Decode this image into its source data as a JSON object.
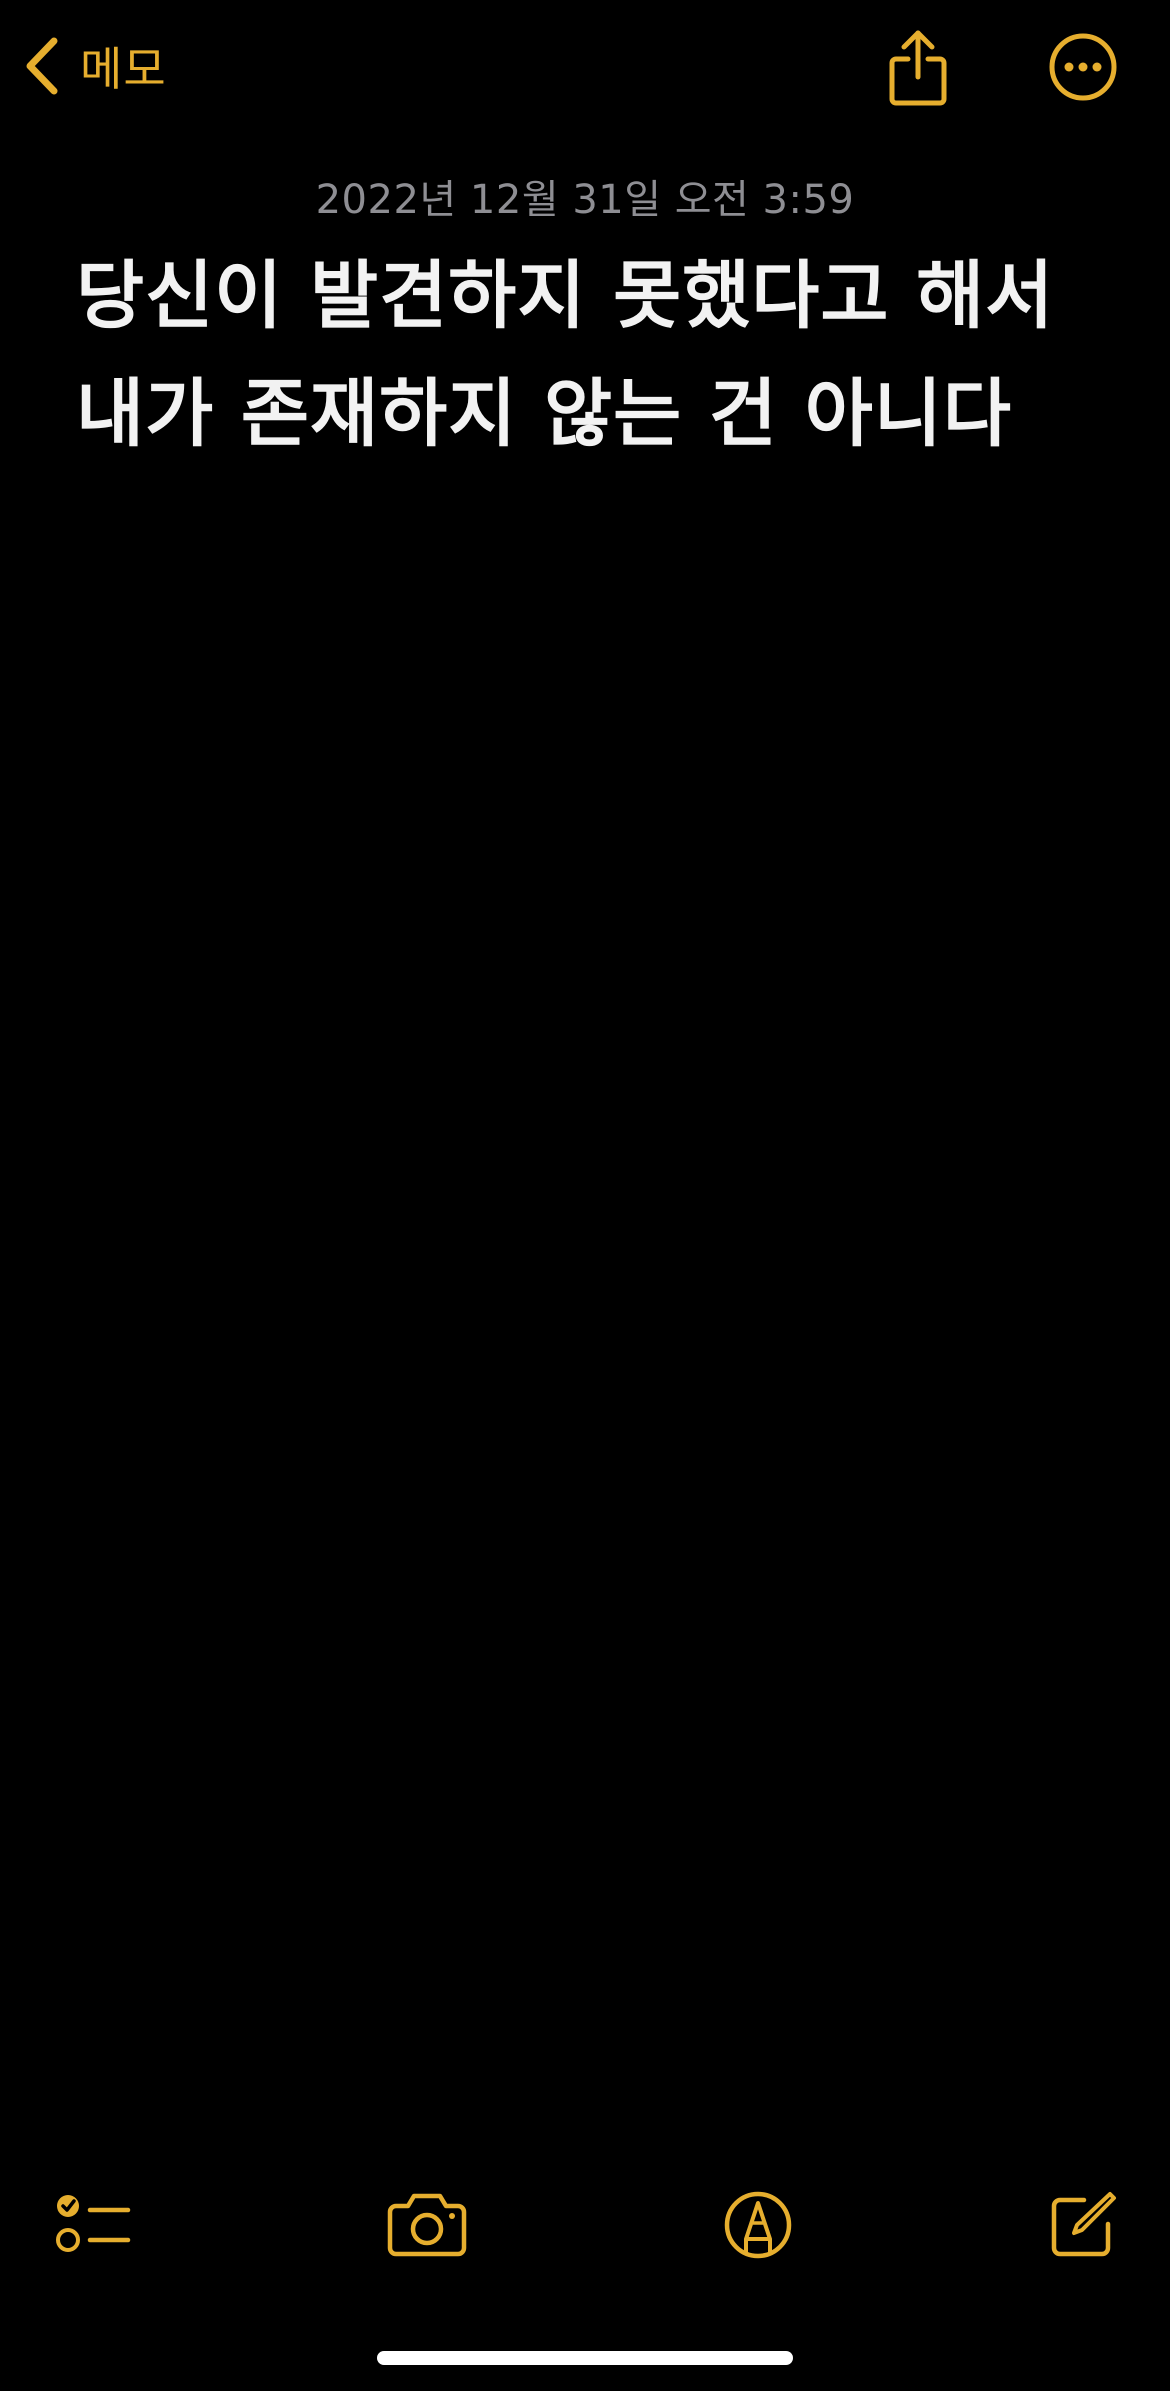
{
  "colors": {
    "accent": "#E6AE2E",
    "background": "#000000",
    "date_text": "#8e8e93",
    "body_text": "#f2f2f2"
  },
  "nav": {
    "back_label": "메모",
    "back_icon": "chevron-left-icon",
    "share_icon": "share-icon",
    "more_icon": "ellipsis-circle-icon"
  },
  "note": {
    "date": "2022년 12월 31일 오전 3:59",
    "title_line_1": "당신이 발견하지 못했다고 해서",
    "title_line_2": "내가 존재하지 않는 건 아니다"
  },
  "toolbar": {
    "checklist_icon": "checklist-icon",
    "camera_icon": "camera-icon",
    "markup_icon": "markup-pen-icon",
    "compose_icon": "compose-icon"
  }
}
